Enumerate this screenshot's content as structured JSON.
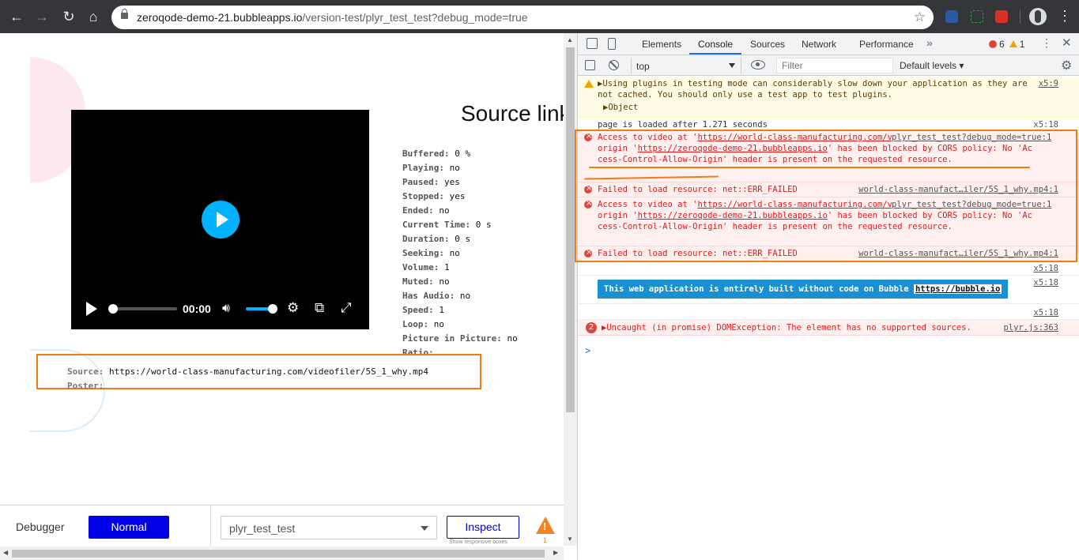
{
  "browser": {
    "url_host": "zeroqode-demo-21.bubbleapps.io",
    "url_path": "/version-test/plyr_test_test?debug_mode=true"
  },
  "app": {
    "source_title": "Source link",
    "player": {
      "time": "00:00"
    },
    "stats": [
      {
        "k": "Buffered:",
        "v": "0 %"
      },
      {
        "k": "Playing:",
        "v": "no"
      },
      {
        "k": "Paused:",
        "v": "yes"
      },
      {
        "k": "Stopped:",
        "v": "yes"
      },
      {
        "k": "Ended:",
        "v": "no"
      },
      {
        "k": "Current Time:",
        "v": "0 s"
      },
      {
        "k": "Duration:",
        "v": "0 s"
      },
      {
        "k": "Seeking:",
        "v": "no"
      },
      {
        "k": "Volume:",
        "v": "1"
      },
      {
        "k": "Muted:",
        "v": "no"
      },
      {
        "k": "Has Audio:",
        "v": "no"
      },
      {
        "k": "Speed:",
        "v": "1"
      },
      {
        "k": "Loop:",
        "v": "no"
      },
      {
        "k": "Picture in Picture:",
        "v": "no"
      },
      {
        "k": "Ratio:",
        "v": ""
      }
    ],
    "source_label": "Source:",
    "source_value": "https://world-class-manufacturing.com/videofiler/5S_1_why.mp4",
    "poster_label": "Poster:"
  },
  "debugger": {
    "label": "Debugger",
    "mode": "Normal",
    "page_select": "plyr_test_test",
    "inspect": "Inspect",
    "inspect_hint": "Show responsive boxes",
    "warn_count": "1"
  },
  "devtools": {
    "tabs": [
      "Elements",
      "Console",
      "Sources",
      "Network",
      "Performance"
    ],
    "more": "»",
    "error_count": "6",
    "warning_count": "1",
    "context": "top",
    "filter_placeholder": "Filter",
    "levels": "Default levels ▾",
    "messages": {
      "m1_text": "▶Using plugins in testing mode can considerably slow down your application as they are not cached. You should only use a test app to test plugins.",
      "m1_object": "▶Object",
      "m1_src": "x5:9",
      "m2_text": "page is loaded after 1.271 seconds",
      "m2_src": "x5:18",
      "m3_pre": "Access to video at '",
      "m3_url": "https://world-class-manufacturing.com/videofiler/5S_1_why.mp4",
      "m3_mid": "' from origin '",
      "m3_origin": "https://zeroqode-demo-21.bubbleapps.io",
      "m3_post": "' has been blocked by CORS policy: No 'Access-Control-Allow-Origin' header is present on the requested resource.",
      "m3_src": "plyr_test_test?debug_mode=true:1",
      "m4_text": "Failed to load resource: net::ERR_FAILED",
      "m4_src": "world-class-manufact…iler/5S_1_why.mp4:1",
      "m5_src": "plyr_test_test?debug_mode=true:1",
      "m6_text": "Failed to load resource: net::ERR_FAILED",
      "m6_src": "world-class-manufact…iler/5S_1_why.mp4:1",
      "m7_src": "x5:18",
      "m8_chip": "This web application is entirely built without code on Bubble",
      "m8_link": "https://bubble.io",
      "m8_src": "x5:18",
      "m9_src": "x5:18",
      "m10_count": "2",
      "m10_text": "▶Uncaught (in promise) DOMException: The element has no supported sources.",
      "m10_src": "plyr.js:363",
      "prompt": ">"
    }
  }
}
